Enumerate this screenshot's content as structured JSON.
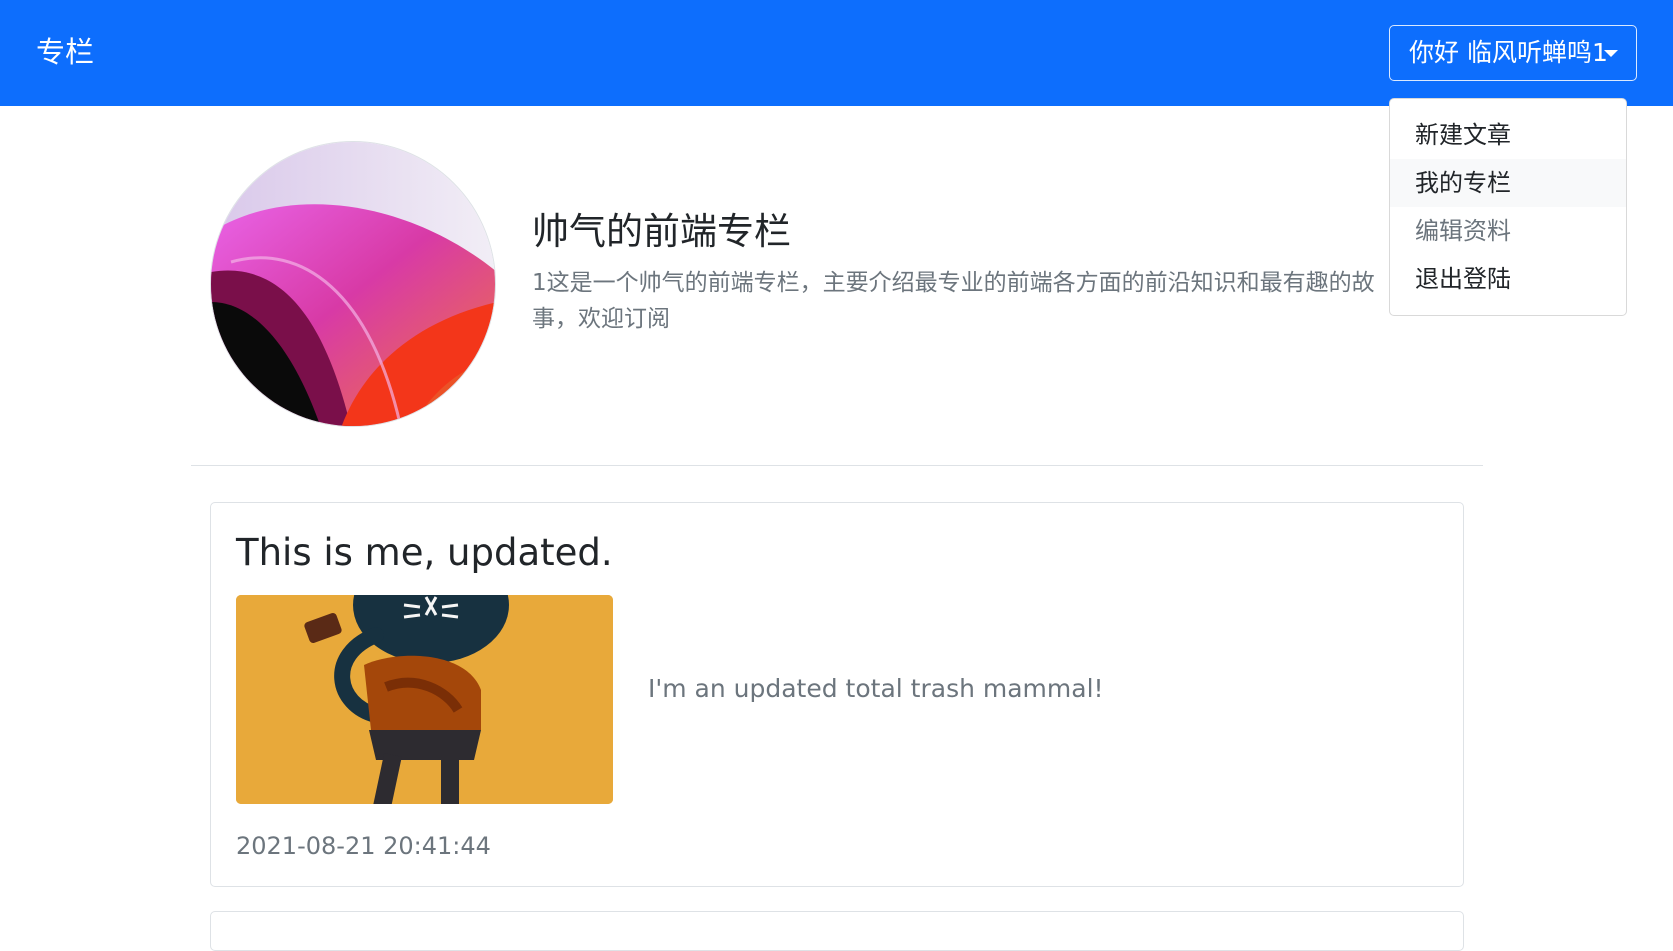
{
  "navbar": {
    "brand": "专栏",
    "user_menu_label": "你好 临风听蝉鸣1"
  },
  "dropdown": {
    "items": [
      {
        "label": "新建文章"
      },
      {
        "label": "我的专栏"
      },
      {
        "label": "编辑资料"
      },
      {
        "label": "退出登陆"
      }
    ]
  },
  "column": {
    "title": "帅气的前端专栏",
    "description": "1这是一个帅气的前端专栏，主要介绍最专业的前端各方面的前沿知识和最有趣的故事，欢迎订阅"
  },
  "posts": [
    {
      "title": "This is me, updated.",
      "excerpt": "I'm an updated total trash mammal!",
      "date": "2021-08-21 20:41:44"
    }
  ],
  "colors": {
    "navbar": "#0d6efd",
    "muted_text": "#6c757d",
    "border": "#dee2e6",
    "post_image_bg": "#e8a93a"
  }
}
